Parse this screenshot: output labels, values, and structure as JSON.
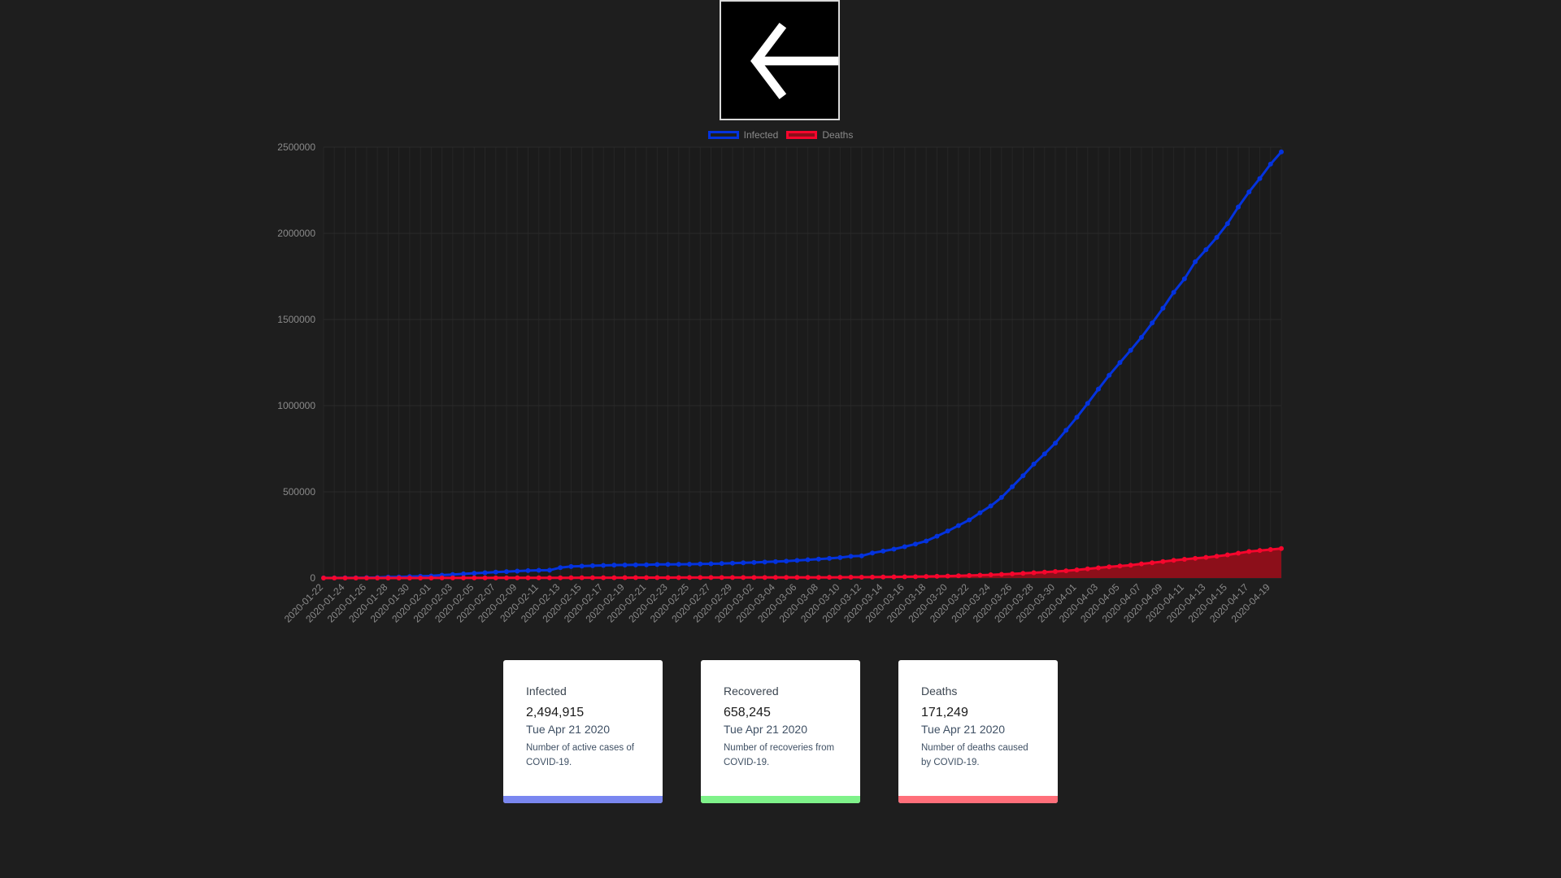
{
  "back_icon": "arrow-left-icon",
  "colors": {
    "background": "#1e1e1e",
    "infected": "#0433de",
    "deaths_line": "#f5062d",
    "deaths_fill": "#8c0f1a",
    "card_infected": "#7a87f0",
    "card_recovered": "#7ff28a",
    "card_deaths": "#ff6f7a"
  },
  "legend": {
    "infected": "Infected",
    "deaths": "Deaths"
  },
  "chart_data": {
    "type": "line",
    "x": [
      "2020-01-22",
      "2020-01-23",
      "2020-01-24",
      "2020-01-25",
      "2020-01-26",
      "2020-01-27",
      "2020-01-28",
      "2020-01-29",
      "2020-01-30",
      "2020-01-31",
      "2020-02-01",
      "2020-02-02",
      "2020-02-03",
      "2020-02-04",
      "2020-02-05",
      "2020-02-06",
      "2020-02-07",
      "2020-02-08",
      "2020-02-09",
      "2020-02-10",
      "2020-02-11",
      "2020-02-12",
      "2020-02-13",
      "2020-02-14",
      "2020-02-15",
      "2020-02-16",
      "2020-02-17",
      "2020-02-18",
      "2020-02-19",
      "2020-02-20",
      "2020-02-21",
      "2020-02-22",
      "2020-02-23",
      "2020-02-24",
      "2020-02-25",
      "2020-02-26",
      "2020-02-27",
      "2020-02-28",
      "2020-02-29",
      "2020-03-01",
      "2020-03-02",
      "2020-03-03",
      "2020-03-04",
      "2020-03-05",
      "2020-03-06",
      "2020-03-07",
      "2020-03-08",
      "2020-03-09",
      "2020-03-10",
      "2020-03-11",
      "2020-03-12",
      "2020-03-13",
      "2020-03-14",
      "2020-03-15",
      "2020-03-16",
      "2020-03-17",
      "2020-03-18",
      "2020-03-19",
      "2020-03-20",
      "2020-03-21",
      "2020-03-22",
      "2020-03-23",
      "2020-03-24",
      "2020-03-25",
      "2020-03-26",
      "2020-03-27",
      "2020-03-28",
      "2020-03-29",
      "2020-03-30",
      "2020-03-31",
      "2020-04-01",
      "2020-04-02",
      "2020-04-03",
      "2020-04-04",
      "2020-04-05",
      "2020-04-06",
      "2020-04-07",
      "2020-04-08",
      "2020-04-09",
      "2020-04-10",
      "2020-04-11",
      "2020-04-12",
      "2020-04-13",
      "2020-04-14",
      "2020-04-15",
      "2020-04-16",
      "2020-04-17",
      "2020-04-18",
      "2020-04-19",
      "2020-04-20"
    ],
    "x_tick_labels": [
      "2020-01-22",
      "2020-01-24",
      "2020-01-26",
      "2020-01-28",
      "2020-01-30",
      "2020-02-01",
      "2020-02-03",
      "2020-02-05",
      "2020-02-07",
      "2020-02-09",
      "2020-02-11",
      "2020-02-13",
      "2020-02-15",
      "2020-02-17",
      "2020-02-19",
      "2020-02-21",
      "2020-02-23",
      "2020-02-25",
      "2020-02-27",
      "2020-02-29",
      "2020-03-02",
      "2020-03-04",
      "2020-03-06",
      "2020-03-08",
      "2020-03-10",
      "2020-03-12",
      "2020-03-14",
      "2020-03-16",
      "2020-03-18",
      "2020-03-20",
      "2020-03-22",
      "2020-03-24",
      "2020-03-26",
      "2020-03-28",
      "2020-03-30",
      "2020-04-01",
      "2020-04-03",
      "2020-04-05",
      "2020-04-07",
      "2020-04-09",
      "2020-04-11",
      "2020-04-13",
      "2020-04-15",
      "2020-04-17",
      "2020-04-19"
    ],
    "ylim": [
      0,
      2500000
    ],
    "y_ticks": [
      0,
      500000,
      1000000,
      1500000,
      2000000,
      2500000
    ],
    "grid": true,
    "legend_position": "top",
    "series": [
      {
        "name": "Infected",
        "fill": false,
        "values": [
          555,
          654,
          941,
          1434,
          2118,
          2927,
          5578,
          6166,
          8234,
          9927,
          12038,
          16787,
          19881,
          23892,
          27635,
          30794,
          34391,
          37120,
          40150,
          42762,
          44802,
          45221,
          60368,
          66885,
          69030,
          71224,
          73258,
          75136,
          75639,
          76197,
          76819,
          78572,
          78958,
          79561,
          80406,
          81388,
          82746,
          84112,
          86011,
          88369,
          90306,
          92840,
          95120,
          97886,
          101801,
          105847,
          109821,
          113590,
          118620,
          125875,
          128352,
          145205,
          156101,
          167454,
          181574,
          197102,
          214821,
          242570,
          272208,
          304507,
          336953,
          378235,
          418045,
          467653,
          529591,
          593291,
          660706,
          720117,
          782365,
          857487,
          932605,
          1013157,
          1095917,
          1176060,
          1249754,
          1321481,
          1396476,
          1479804,
          1565278,
          1657526,
          1735650,
          1834721,
          1904838,
          1976191,
          2056054,
          2152647,
          2240190,
          2317759,
          2401379,
          2472259
        ]
      },
      {
        "name": "Deaths",
        "fill": true,
        "values": [
          17,
          18,
          26,
          42,
          56,
          82,
          131,
          133,
          171,
          213,
          259,
          362,
          426,
          492,
          564,
          634,
          719,
          806,
          906,
          1013,
          1113,
          1118,
          1371,
          1523,
          1666,
          1770,
          1868,
          2007,
          2122,
          2247,
          2251,
          2458,
          2469,
          2629,
          2708,
          2770,
          2814,
          2872,
          2941,
          2996,
          3085,
          3160,
          3254,
          3348,
          3460,
          3558,
          3802,
          3988,
          4262,
          4615,
          4720,
          5404,
          5819,
          6440,
          7126,
          7905,
          8733,
          9867,
          11299,
          12973,
          14651,
          16505,
          18625,
          21181,
          23970,
          27198,
          30652,
          33925,
          37582,
          42107,
          47180,
          53190,
          58787,
          64606,
          69374,
          74565,
          81865,
          88338,
          95455,
          102525,
          108502,
          114091,
          119482,
          125984,
          134176,
          143800,
          153822,
          159509,
          165044,
          171249
        ]
      }
    ]
  },
  "cards": [
    {
      "title": "Infected",
      "value": "2,494,915",
      "date": "Tue Apr 21 2020",
      "desc": "Number of active cases of COVID-19."
    },
    {
      "title": "Recovered",
      "value": "658,245",
      "date": "Tue Apr 21 2020",
      "desc": "Number of recoveries from COVID-19."
    },
    {
      "title": "Deaths",
      "value": "171,249",
      "date": "Tue Apr 21 2020",
      "desc": "Number of deaths caused by COVID-19."
    }
  ]
}
